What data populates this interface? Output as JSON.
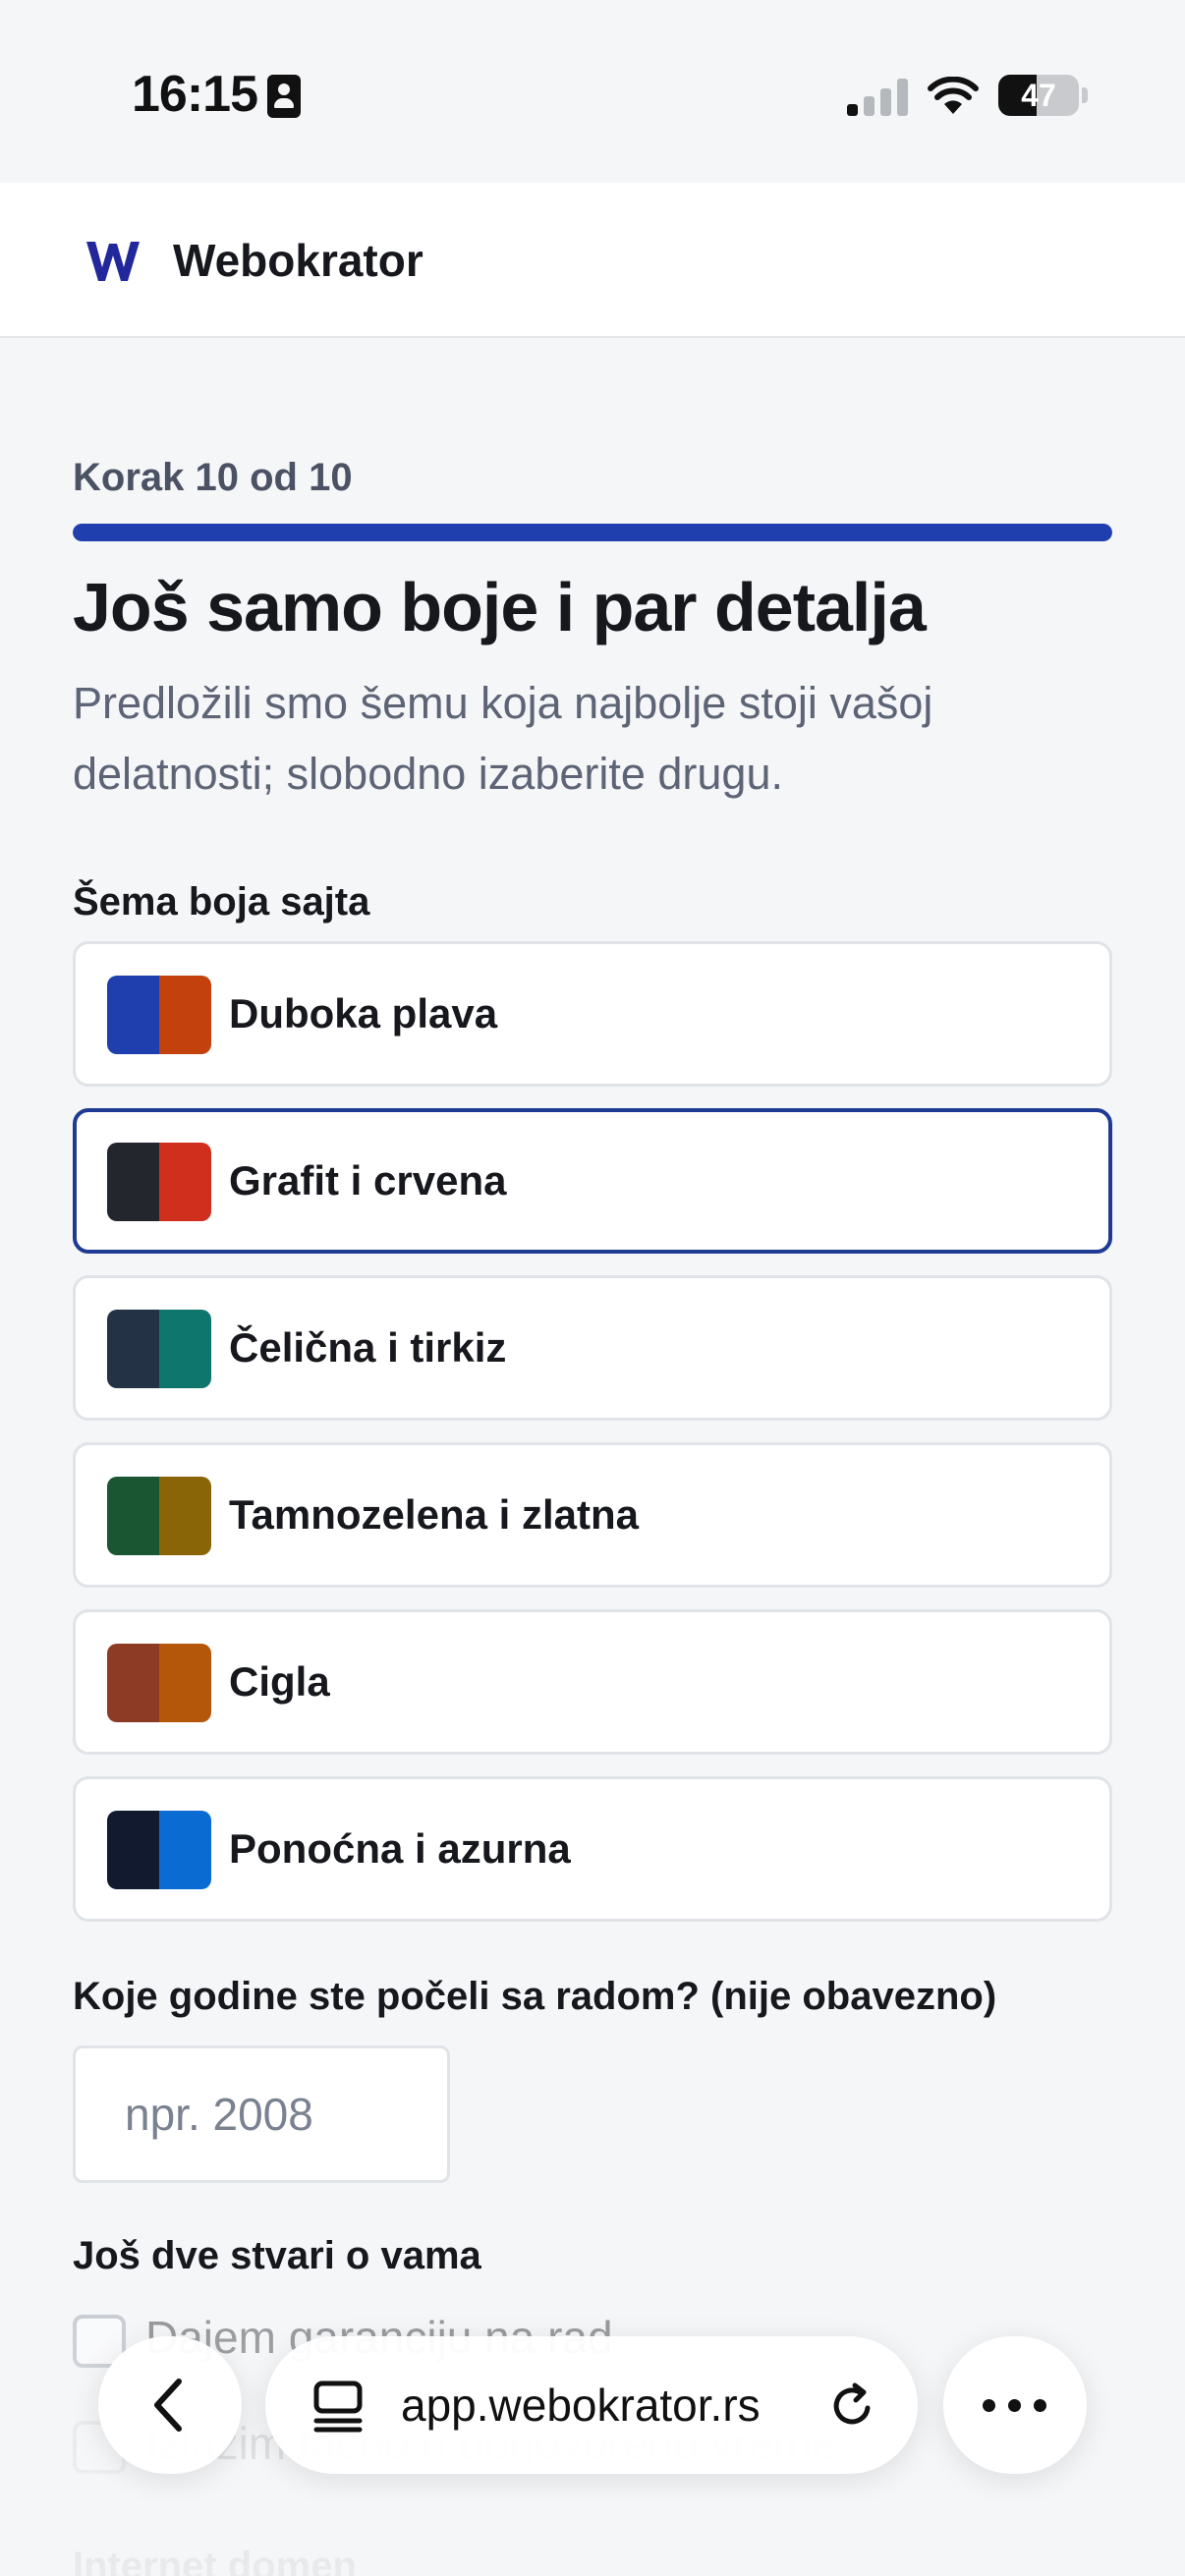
{
  "status_bar": {
    "time": "16:15",
    "battery": "47",
    "battery_level": 0.47,
    "icons": [
      "id-card-icon",
      "cellular-signal-icon",
      "wifi-icon",
      "battery-icon"
    ]
  },
  "header": {
    "brand": "Webokrator",
    "logo_color": "#23279c"
  },
  "wizard": {
    "step_label": "Korak 10 od 10",
    "progress": 1.0,
    "title": "Još samo boje i par detalja",
    "subtitle": "Predložili smo šemu koja najbolje stoji vašoj delatnosti; slobodno izaberite drugu."
  },
  "color_schemes": {
    "label": "Šema boja sajta",
    "selected_index": 1,
    "options": [
      {
        "name": "Duboka plava",
        "colors": [
          "#1f3fae",
          "#c2410c"
        ]
      },
      {
        "name": "Grafit i crvena",
        "colors": [
          "#23262d",
          "#d02f1e"
        ]
      },
      {
        "name": "Čelična i tirkiz",
        "colors": [
          "#243245",
          "#0f766e"
        ]
      },
      {
        "name": "Tamnozelena i zlatna",
        "colors": [
          "#1a5632",
          "#8a6508"
        ]
      },
      {
        "name": "Cigla",
        "colors": [
          "#8d3b24",
          "#b4570b"
        ]
      },
      {
        "name": "Ponoćna i azurna",
        "colors": [
          "#111a2e",
          "#0a6bd2"
        ]
      }
    ]
  },
  "year_field": {
    "label": "Koje godine ste počeli sa radom? (nije obavezno)",
    "placeholder": "npr. 2008",
    "value": ""
  },
  "extras": {
    "label": "Još dve stvari o vama",
    "items": [
      {
        "label": "Dajem garanciju na rad",
        "checked": false
      },
      {
        "label": "Izlazim tačno u dogovoreno vreme",
        "checked": false
      }
    ]
  },
  "domain_section": {
    "label": "Internet domen"
  },
  "browser": {
    "url": "app.webokrator.rs"
  },
  "colors": {
    "accent": "#1f3fae",
    "selected_border": "#1f3a93"
  }
}
